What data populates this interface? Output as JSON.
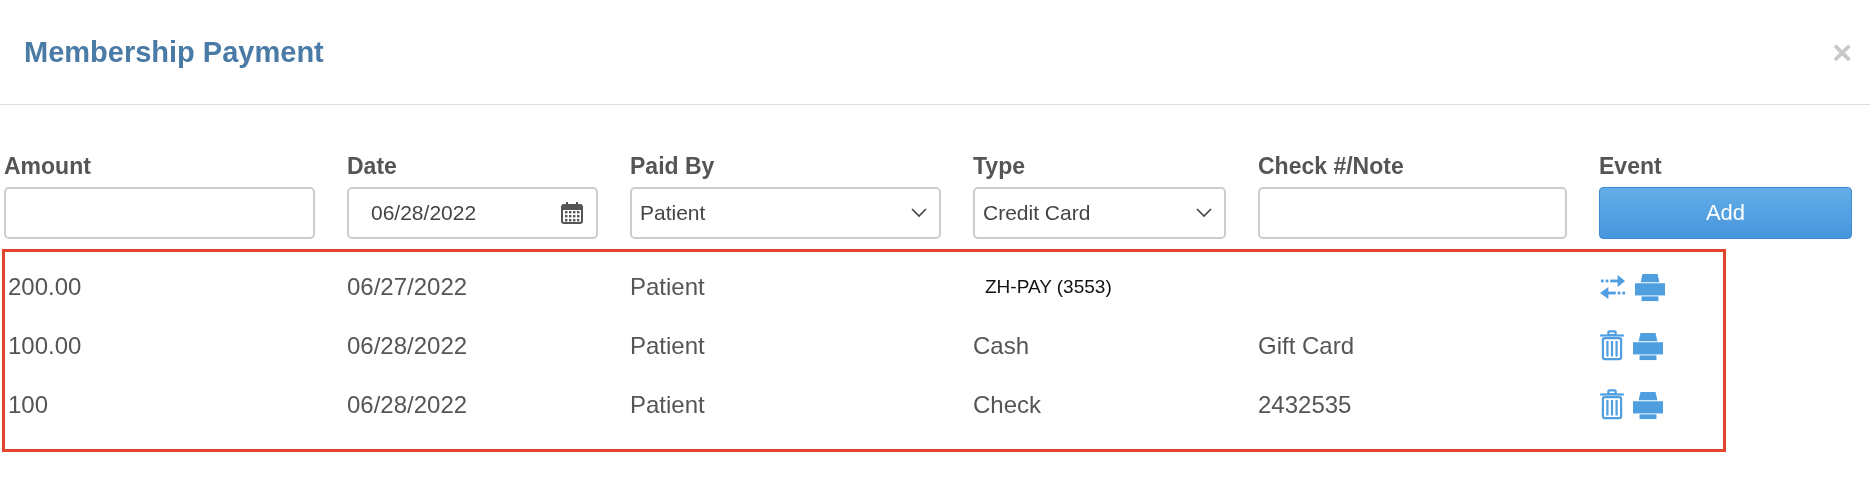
{
  "dialog": {
    "title": "Membership Payment",
    "close": "×"
  },
  "form": {
    "fields": [
      {
        "label": "Amount",
        "kind": "text"
      },
      {
        "label": "Date",
        "kind": "date",
        "value": "06/28/2022"
      },
      {
        "label": "Paid By",
        "kind": "select",
        "value": "Patient"
      },
      {
        "label": "Type",
        "kind": "select",
        "value": "Credit Card"
      },
      {
        "label": "Check #/Note",
        "kind": "text"
      },
      {
        "label": "Event",
        "kind": "button",
        "value": "Add"
      }
    ]
  },
  "payments": [
    {
      "kind": "gateway",
      "amount": "200.00",
      "date": "06/27/2022",
      "paid_by": "Patient",
      "type": "ZH-PAY (3553)",
      "actions": [
        {
          "kind": "transfer"
        },
        {
          "kind": "print"
        }
      ]
    },
    {
      "kind": "manual",
      "amount": "100.00",
      "date": "06/28/2022",
      "paid_by": "Patient",
      "type": "Cash",
      "note": "Gift Card",
      "actions": [
        {
          "kind": "delete"
        },
        {
          "kind": "print"
        }
      ]
    },
    {
      "kind": "manual",
      "amount": "100",
      "date": "06/28/2022",
      "paid_by": "Patient",
      "type": "Check",
      "note": "2432535",
      "actions": [
        {
          "kind": "delete"
        },
        {
          "kind": "print"
        }
      ]
    }
  ]
}
